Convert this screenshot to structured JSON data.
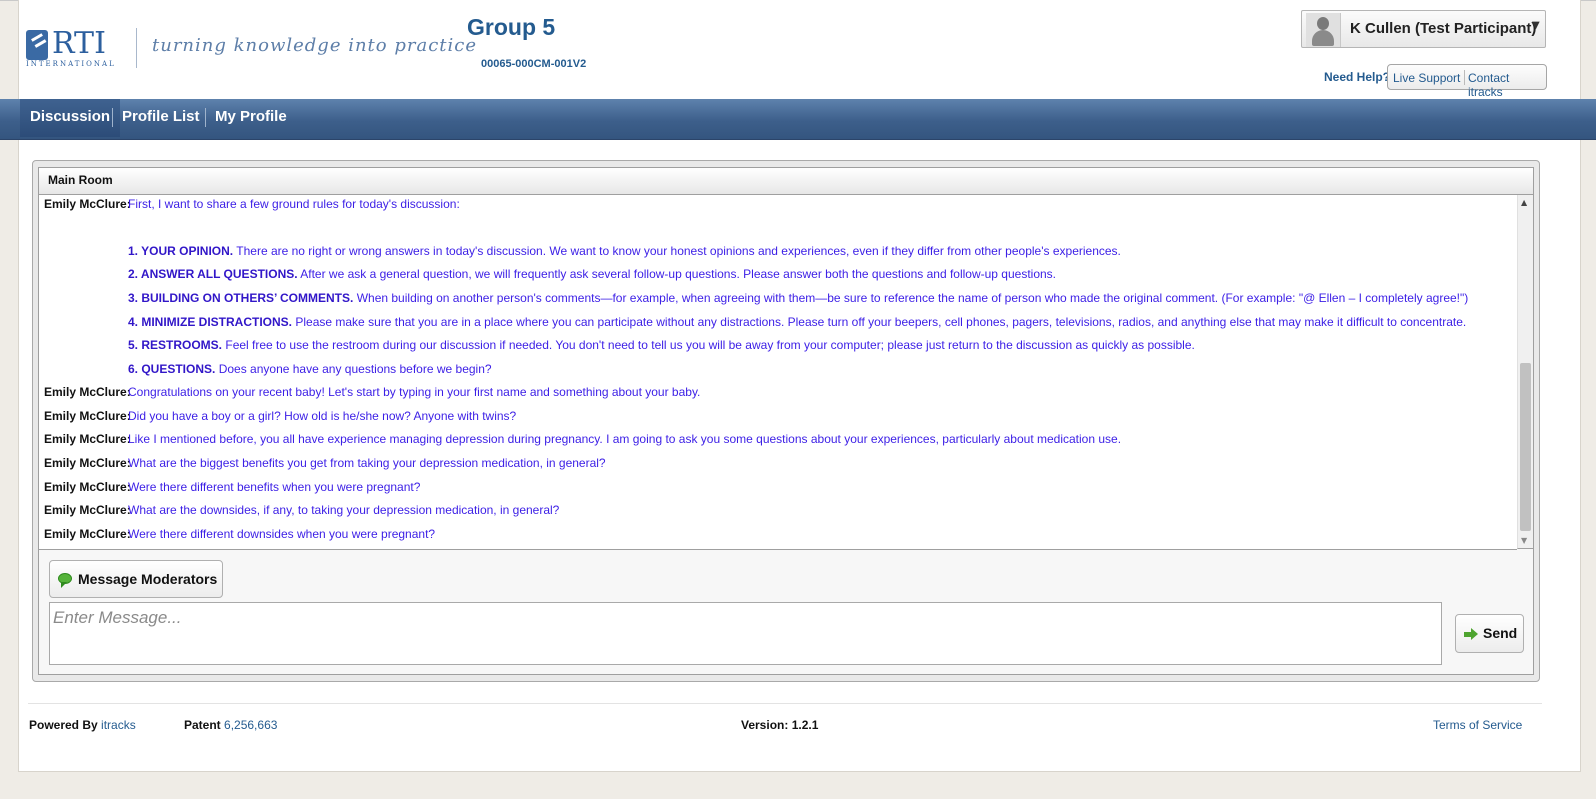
{
  "header": {
    "logo_text": "RTI",
    "logo_sub": "INTERNATIONAL",
    "tagline": "turning knowledge into practice",
    "group_title": "Group 5",
    "group_code": "00065-000CM-001V2",
    "user_name": "K Cullen (Test Participant)",
    "help_label": "Need Help?",
    "live_support": "Live Support",
    "contact": "Contact itracks"
  },
  "nav": {
    "tabs": [
      {
        "label": "Discussion",
        "active": true
      },
      {
        "label": "Profile List",
        "active": false
      },
      {
        "label": "My Profile",
        "active": false
      }
    ]
  },
  "room": {
    "title": "Main Room",
    "messages": [
      {
        "author": "Emily McClure:",
        "text": "First, I want to share a few ground rules for today's discussion:"
      },
      {
        "author": "Emily McClure:",
        "text": "Congratulations on your recent baby! Let's start by typing in your first name and something about your baby."
      },
      {
        "author": "Emily McClure:",
        "text": "Did you have a boy or a girl? How old is he/she now? Anyone with twins?"
      },
      {
        "author": "Emily McClure:",
        "text": "Like I mentioned before, you all have experience managing depression during pregnancy. I am going to ask you some questions about your experiences, particularly about medication use."
      },
      {
        "author": "Emily McClure:",
        "text": "What are the biggest benefits you get from taking your depression medication, in general?"
      },
      {
        "author": "Emily McClure:",
        "text": "Were there different benefits when you were pregnant?"
      },
      {
        "author": "Emily McClure:",
        "text": "What are the downsides, if any, to taking your depression medication, in general?"
      },
      {
        "author": "Emily McClure:",
        "text": "Were there different downsides when you were pregnant?"
      }
    ],
    "rules": [
      {
        "heading": "1. YOUR OPINION.",
        "text": "There are no right or wrong answers in today's discussion. We want to know your honest opinions and experiences, even if they differ from other people's experiences."
      },
      {
        "heading": "2. ANSWER ALL QUESTIONS.",
        "text": "After we ask a general question, we will frequently ask several follow-up questions. Please answer both the questions and follow-up questions."
      },
      {
        "heading": "3. BUILDING ON OTHERS’ COMMENTS.",
        "text": "When building on another person's comments—for example, when agreeing with them—be sure to reference the name of person who made the original comment. (For example: \"@ Ellen – I completely agree!\")"
      },
      {
        "heading": "4. MINIMIZE DISTRACTIONS.",
        "text": "Please make sure that you are in a place where you can participate without any distractions. Please turn off your beepers, cell phones, pagers, televisions, radios, and anything else that may make it difficult to concentrate."
      },
      {
        "heading": "5. RESTROOMS.",
        "text": "Feel free to use the restroom during our discussion if needed. You don't need to tell us you will be away from your computer; please just return to the discussion as quickly as possible."
      },
      {
        "heading": "6. QUESTIONS.",
        "text": "Does anyone have any questions before we begin?"
      }
    ]
  },
  "composer": {
    "moderators_button": "Message Moderators",
    "placeholder": "Enter Message...",
    "send_button": "Send"
  },
  "footer": {
    "powered_label": "Powered By",
    "powered_value": "itracks",
    "patent_label": "Patent",
    "patent_value": "6,256,663",
    "version_label": "Version:",
    "version_value": "1.2.1",
    "terms": "Terms of Service"
  },
  "colors": {
    "nav": "#3d5f8b",
    "brand": "#245b8f",
    "message_text": "#3b1ee6"
  }
}
